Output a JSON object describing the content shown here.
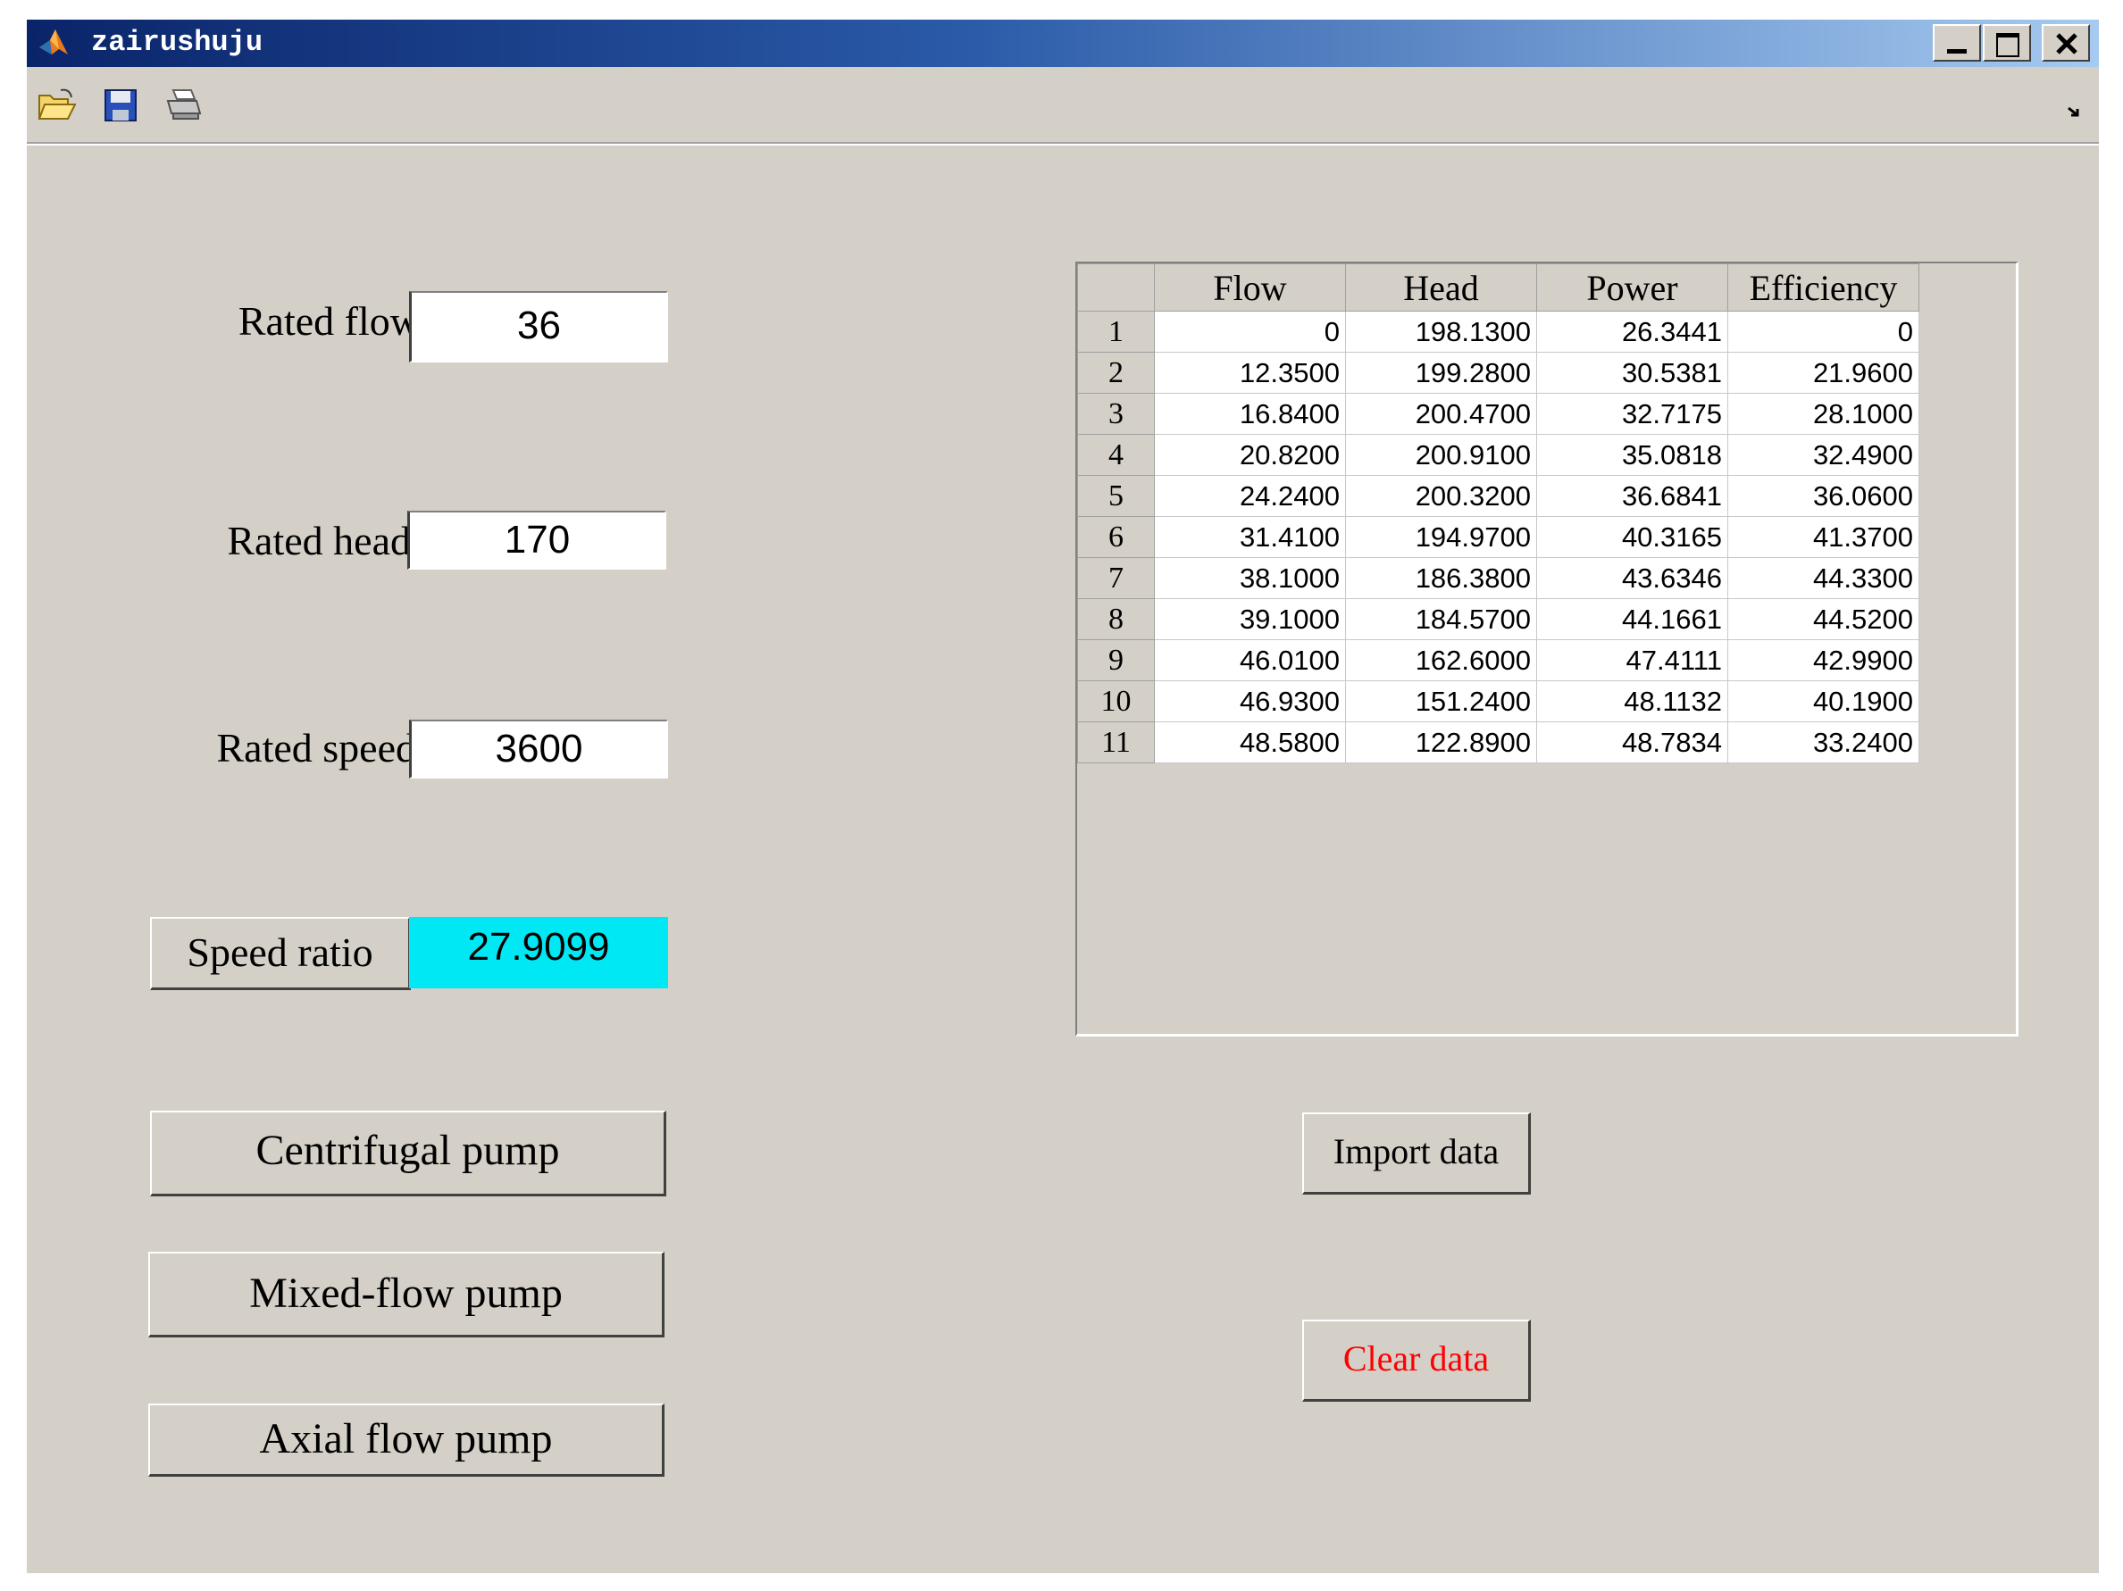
{
  "window": {
    "title": "zairushuju"
  },
  "toolbar": {
    "icons": [
      "open-folder-icon",
      "save-icon",
      "print-icon"
    ]
  },
  "inputs": {
    "rated_flow": {
      "label": "Rated flow",
      "value": "36"
    },
    "rated_head": {
      "label": "Rated head",
      "value": "170"
    },
    "rated_speed": {
      "label": "Rated speed",
      "value": "3600"
    }
  },
  "speed_ratio": {
    "label": "Speed ratio",
    "value": "27.9099",
    "color": "#00e8f4"
  },
  "pump_buttons": {
    "centrifugal": "Centrifugal pump",
    "mixed_flow": "Mixed-flow pump",
    "axial_flow": "Axial flow pump"
  },
  "actions": {
    "import_label": "Import data",
    "clear_label": "Clear data",
    "clear_color": "#ff0000"
  },
  "table": {
    "columns": [
      "Flow",
      "Head",
      "Power",
      "Efficiency"
    ],
    "rows": [
      {
        "num": "1",
        "cells": [
          "0",
          "198.1300",
          "26.3441",
          "0"
        ]
      },
      {
        "num": "2",
        "cells": [
          "12.3500",
          "199.2800",
          "30.5381",
          "21.9600"
        ]
      },
      {
        "num": "3",
        "cells": [
          "16.8400",
          "200.4700",
          "32.7175",
          "28.1000"
        ]
      },
      {
        "num": "4",
        "cells": [
          "20.8200",
          "200.9100",
          "35.0818",
          "32.4900"
        ]
      },
      {
        "num": "5",
        "cells": [
          "24.2400",
          "200.3200",
          "36.6841",
          "36.0600"
        ]
      },
      {
        "num": "6",
        "cells": [
          "31.4100",
          "194.9700",
          "40.3165",
          "41.3700"
        ]
      },
      {
        "num": "7",
        "cells": [
          "38.1000",
          "186.3800",
          "43.6346",
          "44.3300"
        ]
      },
      {
        "num": "8",
        "cells": [
          "39.1000",
          "184.5700",
          "44.1661",
          "44.5200"
        ]
      },
      {
        "num": "9",
        "cells": [
          "46.0100",
          "162.6000",
          "47.4111",
          "42.9900"
        ]
      },
      {
        "num": "10",
        "cells": [
          "46.9300",
          "151.2400",
          "48.1132",
          "40.1900"
        ]
      },
      {
        "num": "11",
        "cells": [
          "48.5800",
          "122.8900",
          "48.7834",
          "33.2400"
        ]
      }
    ]
  }
}
